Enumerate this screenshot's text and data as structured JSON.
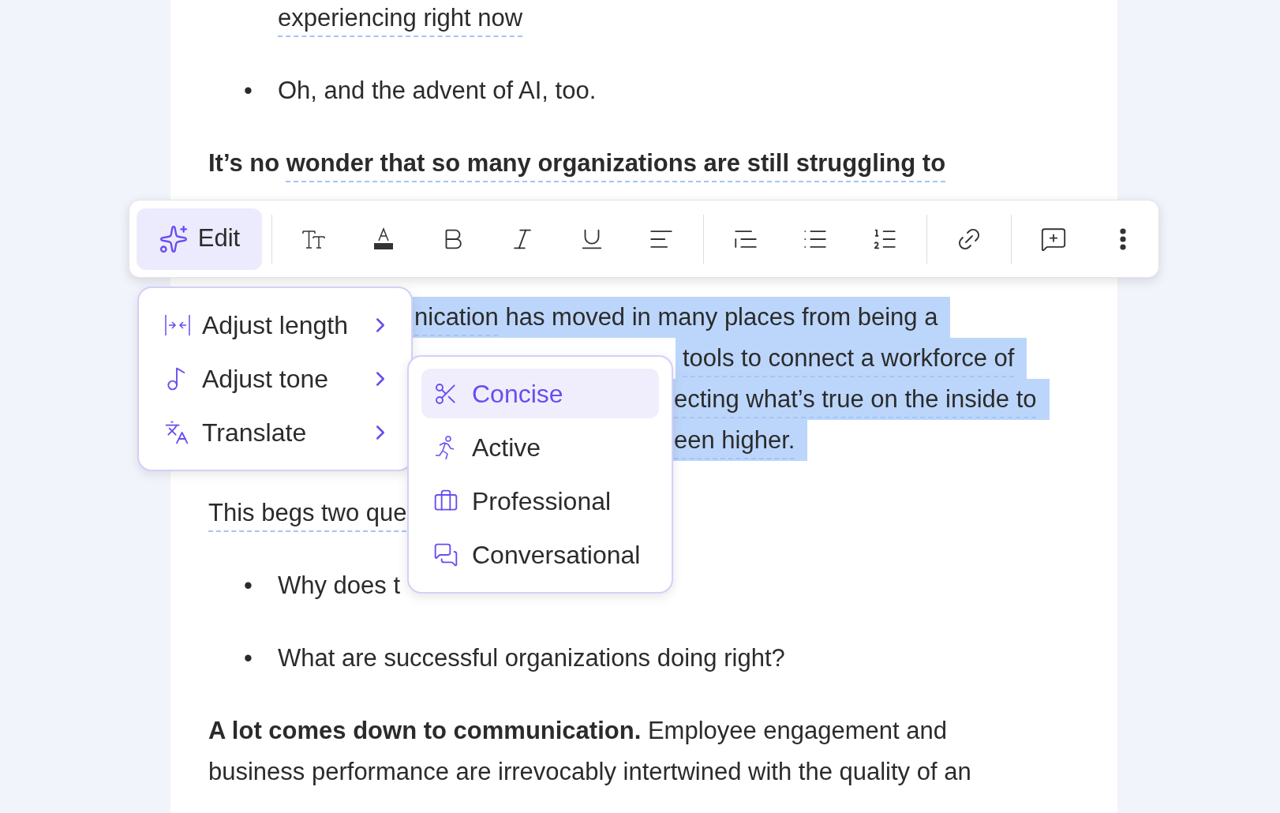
{
  "document": {
    "bullet": "•",
    "top_lines": [
      {
        "kind": "continuation",
        "segments": [
          {
            "text": "experiencing right now",
            "underlined": true
          }
        ]
      },
      {
        "kind": "bullet",
        "segments": [
          {
            "text": "Oh, and the advent of AI, too."
          }
        ]
      },
      {
        "kind": "text",
        "segments": [
          {
            "text": "It’s no ",
            "bold": true
          },
          {
            "text": "wonder that so many organizations are still struggling to",
            "bold": true,
            "underlined": true
          }
        ]
      }
    ],
    "selection_lines": [
      {
        "segments": [
          {
            "text": "nication",
            "underlined": true,
            "selected": true
          },
          {
            "text": " has moved in many places from being a",
            "selected": true
          }
        ]
      },
      {
        "segments": [
          {
            "text": "tools to connect a workforce of",
            "underlined": true,
            "selected": true
          }
        ]
      },
      {
        "segments": [
          {
            "text": "ecting what’s true on the inside to",
            "underlined": true,
            "selected": true
          }
        ]
      },
      {
        "segments": [
          {
            "text": "een higher.",
            "underlined": true,
            "selected": true
          }
        ]
      }
    ],
    "bottom_lines": [
      {
        "kind": "text",
        "segments": [
          {
            "text": "This begs two que",
            "underlined": true
          }
        ]
      },
      {
        "kind": "bullet",
        "segments": [
          {
            "text": "Why does t"
          }
        ]
      },
      {
        "kind": "bullet",
        "segments": [
          {
            "text": "What are successful organizations doing right?"
          }
        ]
      },
      {
        "kind": "text",
        "segments": [
          {
            "text": "A lot comes down to communication.",
            "bold": true
          },
          {
            "text": " Employee engagement and"
          }
        ]
      },
      {
        "kind": "continuation_text",
        "segments": [
          {
            "text": "business performance are irrevocably intertwined with the quality of an"
          }
        ]
      }
    ]
  },
  "toolbar": {
    "edit_label": "Edit",
    "edit_selected": true,
    "groups": [
      [
        {
          "kind": "text_size"
        },
        {
          "kind": "highlight"
        },
        {
          "kind": "bold"
        },
        {
          "kind": "italic"
        },
        {
          "kind": "underline"
        },
        {
          "kind": "align"
        }
      ],
      [
        {
          "kind": "quote"
        },
        {
          "kind": "bullets"
        },
        {
          "kind": "numbers"
        }
      ],
      [
        {
          "kind": "link"
        }
      ],
      [
        {
          "kind": "comment"
        },
        {
          "kind": "more"
        }
      ]
    ]
  },
  "edit_menu": [
    {
      "label": "Adjust length"
    },
    {
      "label": "Adjust tone"
    },
    {
      "label": "Translate"
    }
  ],
  "tone_menu": [
    {
      "label": "Concise",
      "selected": true
    },
    {
      "label": "Active",
      "selected": false
    },
    {
      "label": "Professional",
      "selected": false
    },
    {
      "label": "Conversational",
      "selected": false
    }
  ]
}
